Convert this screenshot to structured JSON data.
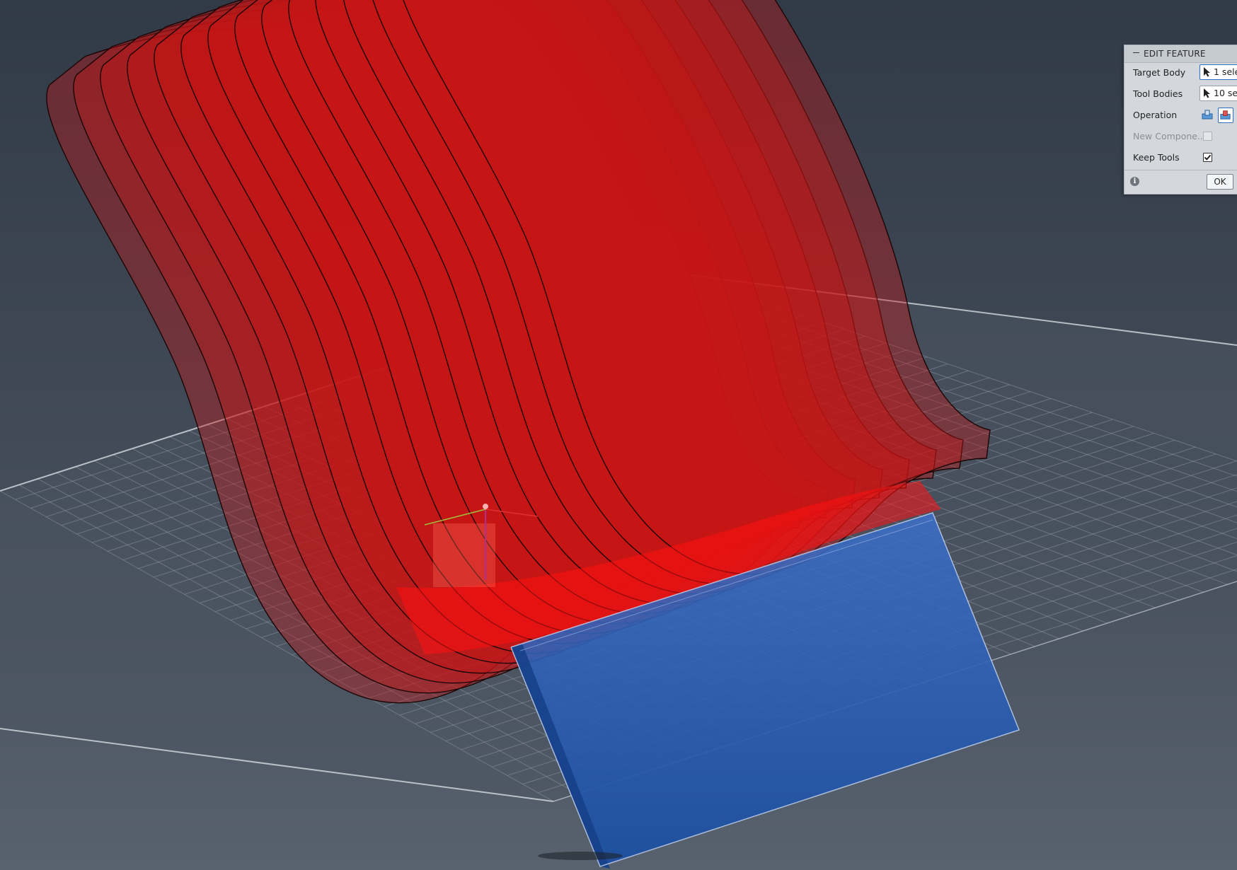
{
  "panel": {
    "title": "EDIT FEATURE",
    "target_body": {
      "label": "Target Body",
      "value": "1 sele"
    },
    "tool_bodies": {
      "label": "Tool Bodies",
      "value": "10 se"
    },
    "operation": {
      "label": "Operation",
      "options": [
        "cut-operation-icon",
        "intersect-operation-icon"
      ],
      "selected": 1
    },
    "new_component": {
      "label": "New Compone...",
      "enabled": false,
      "checked": false
    },
    "keep_tools": {
      "label": "Keep Tools",
      "enabled": true,
      "checked": true
    },
    "ok_label": "OK"
  },
  "colors": {
    "background_top": "#323b48",
    "background_bottom": "#56606c",
    "grid_line": "#a7aeb8",
    "red_body": "#c81414",
    "blue_body": "#1f55b6",
    "selection_blue": "#2e6fc4"
  }
}
